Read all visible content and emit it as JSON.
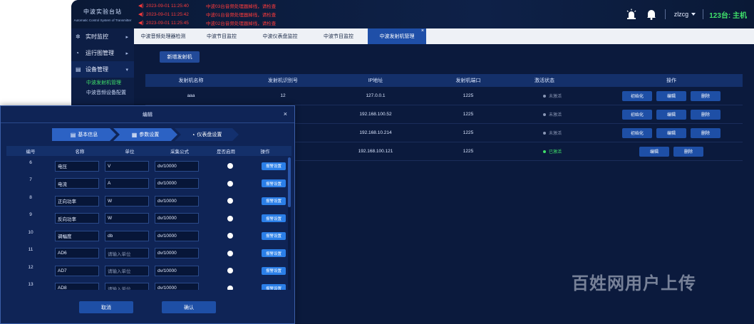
{
  "logo": {
    "title": "中波实验台站",
    "subtitle": "Automatic Control System of Transmitter"
  },
  "alarms": [
    {
      "time": "2023-09-01 11:25:40",
      "msg": "中波03台音频处理器掉线，请检查"
    },
    {
      "time": "2023-09-01 11:25:42",
      "msg": "中波01台音频处理器掉线，请检查"
    },
    {
      "time": "2023-09-01 11:25:45",
      "msg": "中波02台音频处理器掉线，请检查"
    }
  ],
  "header": {
    "username": "zlzcg",
    "station": "123台: 主机"
  },
  "sidebar": {
    "items": [
      {
        "label": "实时监控",
        "icon": "monitor-icon"
      },
      {
        "label": "运行图管理",
        "icon": "schedule-icon"
      },
      {
        "label": "设备管理",
        "icon": "device-icon"
      }
    ],
    "subitems": [
      {
        "label": "中波发射机管理"
      },
      {
        "label": "中波音频设备配置"
      }
    ]
  },
  "tabs": [
    {
      "label": "中波音频处理器检测"
    },
    {
      "label": "中波节目监控"
    },
    {
      "label": "中波仪表盘监控"
    },
    {
      "label": "中波节目监控"
    },
    {
      "label": "中波发射机管理"
    }
  ],
  "main": {
    "new_button": "新增发射机",
    "columns": [
      "发射机名称",
      "发射机识别号",
      "IP地址",
      "发射机端口",
      "激活状态",
      "操作"
    ],
    "rows": [
      {
        "name": "aaa",
        "id": "12",
        "ip": "127.0.0.1",
        "port": "1225",
        "status": "未激活"
      },
      {
        "name": "",
        "id": "",
        "ip": "192.168.100.52",
        "port": "1225",
        "status": "未激活"
      },
      {
        "name": "",
        "id": "",
        "ip": "192.168.10.214",
        "port": "1225",
        "status": "未激活"
      },
      {
        "name": "",
        "id": "",
        "ip": "192.168.100.121",
        "port": "1225",
        "status": "已激活"
      }
    ],
    "actions": {
      "init": "初始化",
      "edit": "编辑",
      "delete": "删除"
    }
  },
  "modal": {
    "title": "编辑",
    "steps": [
      "基本信息",
      "参数设置",
      "仪表盘设置"
    ],
    "columns": [
      "编号",
      "名称",
      "单位",
      "采集公式",
      "是否启用",
      "操作"
    ],
    "rows": [
      {
        "no": "6",
        "name": "电压",
        "unit": "V",
        "formula": "dv/10000"
      },
      {
        "no": "7",
        "name": "电流",
        "unit": "A",
        "formula": "dv/10000"
      },
      {
        "no": "8",
        "name": "正向功率",
        "unit": "W",
        "formula": "dv/10000"
      },
      {
        "no": "9",
        "name": "反向功率",
        "unit": "W",
        "formula": "dv/10000"
      },
      {
        "no": "10",
        "name": "调幅度",
        "unit": "db",
        "formula": "dv/10000"
      },
      {
        "no": "11",
        "name": "AD6",
        "unit": "",
        "formula": "dv/10000"
      },
      {
        "no": "12",
        "name": "AD7",
        "unit": "",
        "formula": "dv/10000"
      },
      {
        "no": "13",
        "name": "AD8",
        "unit": "",
        "formula": "dv/10000"
      }
    ],
    "unit_placeholder": "请输入单位",
    "alarm_button": "报警设置",
    "cancel": "取消",
    "confirm": "确认"
  },
  "watermark": "百姓网用户上传",
  "colors": {
    "accent": "#1f4fa8",
    "active_green": "#3fe06a",
    "alarm_red": "#ff3b3b",
    "bg": "#0b1a3d"
  }
}
